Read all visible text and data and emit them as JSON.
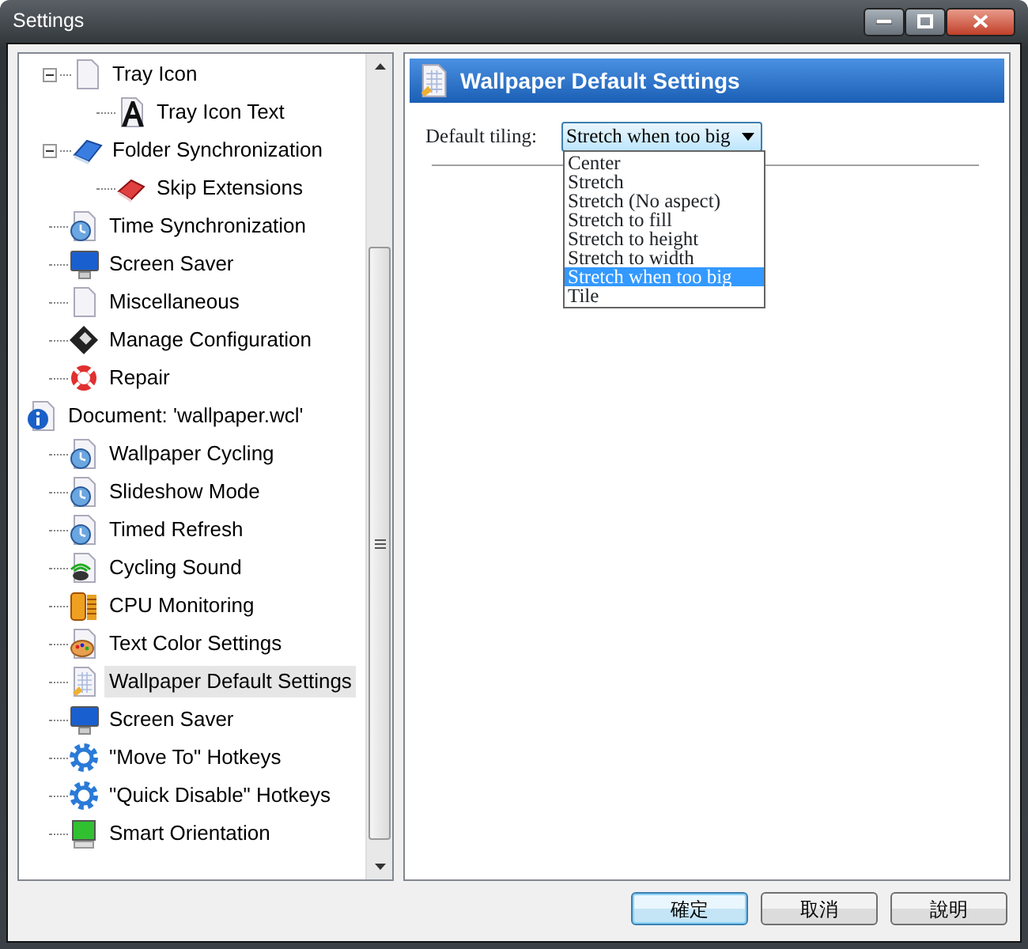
{
  "window": {
    "title": "Settings"
  },
  "tree": {
    "continued_items": [
      {
        "label": "Tray Icon",
        "kind": "page",
        "expanded": true,
        "selected": false,
        "children": [
          {
            "label": "Tray Icon Text",
            "kind": "letter",
            "selected": false
          }
        ]
      },
      {
        "label": "Folder Synchronization",
        "kind": "folder",
        "expanded": true,
        "selected": false,
        "children": [
          {
            "label": "Skip Extensions",
            "kind": "eraser",
            "selected": false
          }
        ]
      },
      {
        "label": "Time Synchronization",
        "kind": "clock",
        "selected": false
      },
      {
        "label": "Screen Saver",
        "kind": "monitor",
        "selected": false
      },
      {
        "label": "Miscellaneous",
        "kind": "page",
        "selected": false
      },
      {
        "label": "Manage Configuration",
        "kind": "disk",
        "selected": false
      },
      {
        "label": "Repair",
        "kind": "lifebuoy",
        "selected": false
      }
    ],
    "roots": [
      {
        "label": "Document: 'wallpaper.wcl'",
        "kind": "info",
        "selected": false,
        "children": [
          {
            "label": "Wallpaper Cycling",
            "kind": "clock",
            "selected": false
          },
          {
            "label": "Slideshow Mode",
            "kind": "clock",
            "selected": false
          },
          {
            "label": "Timed Refresh",
            "kind": "clock",
            "selected": false
          },
          {
            "label": "Cycling Sound",
            "kind": "sound",
            "selected": false
          },
          {
            "label": "CPU Monitoring",
            "kind": "battery",
            "selected": false
          },
          {
            "label": "Text Color Settings",
            "kind": "palette",
            "selected": false
          },
          {
            "label": "Wallpaper Default Settings",
            "kind": "sheet",
            "selected": true
          },
          {
            "label": "Screen Saver",
            "kind": "monitor",
            "selected": false
          },
          {
            "label": "\"Move To\" Hotkeys",
            "kind": "gear",
            "selected": false
          },
          {
            "label": "\"Quick Disable\" Hotkeys",
            "kind": "gear",
            "selected": false
          },
          {
            "label": "Smart Orientation",
            "kind": "screen",
            "selected": false
          }
        ]
      }
    ]
  },
  "panel": {
    "title": "Wallpaper Default Settings",
    "tiling_label": "Default tiling:",
    "tiling_value": "Stretch when too big",
    "options": [
      {
        "label": "Center",
        "selected": false
      },
      {
        "label": "Stretch",
        "selected": false
      },
      {
        "label": "Stretch (No aspect)",
        "selected": false
      },
      {
        "label": "Stretch to fill",
        "selected": false
      },
      {
        "label": "Stretch to height",
        "selected": false
      },
      {
        "label": "Stretch to width",
        "selected": false
      },
      {
        "label": "Stretch when too big",
        "selected": true
      },
      {
        "label": "Tile",
        "selected": false
      }
    ]
  },
  "buttons": [
    {
      "label": "確定",
      "default": true
    },
    {
      "label": "取消",
      "default": false
    },
    {
      "label": "說明",
      "default": false
    }
  ]
}
